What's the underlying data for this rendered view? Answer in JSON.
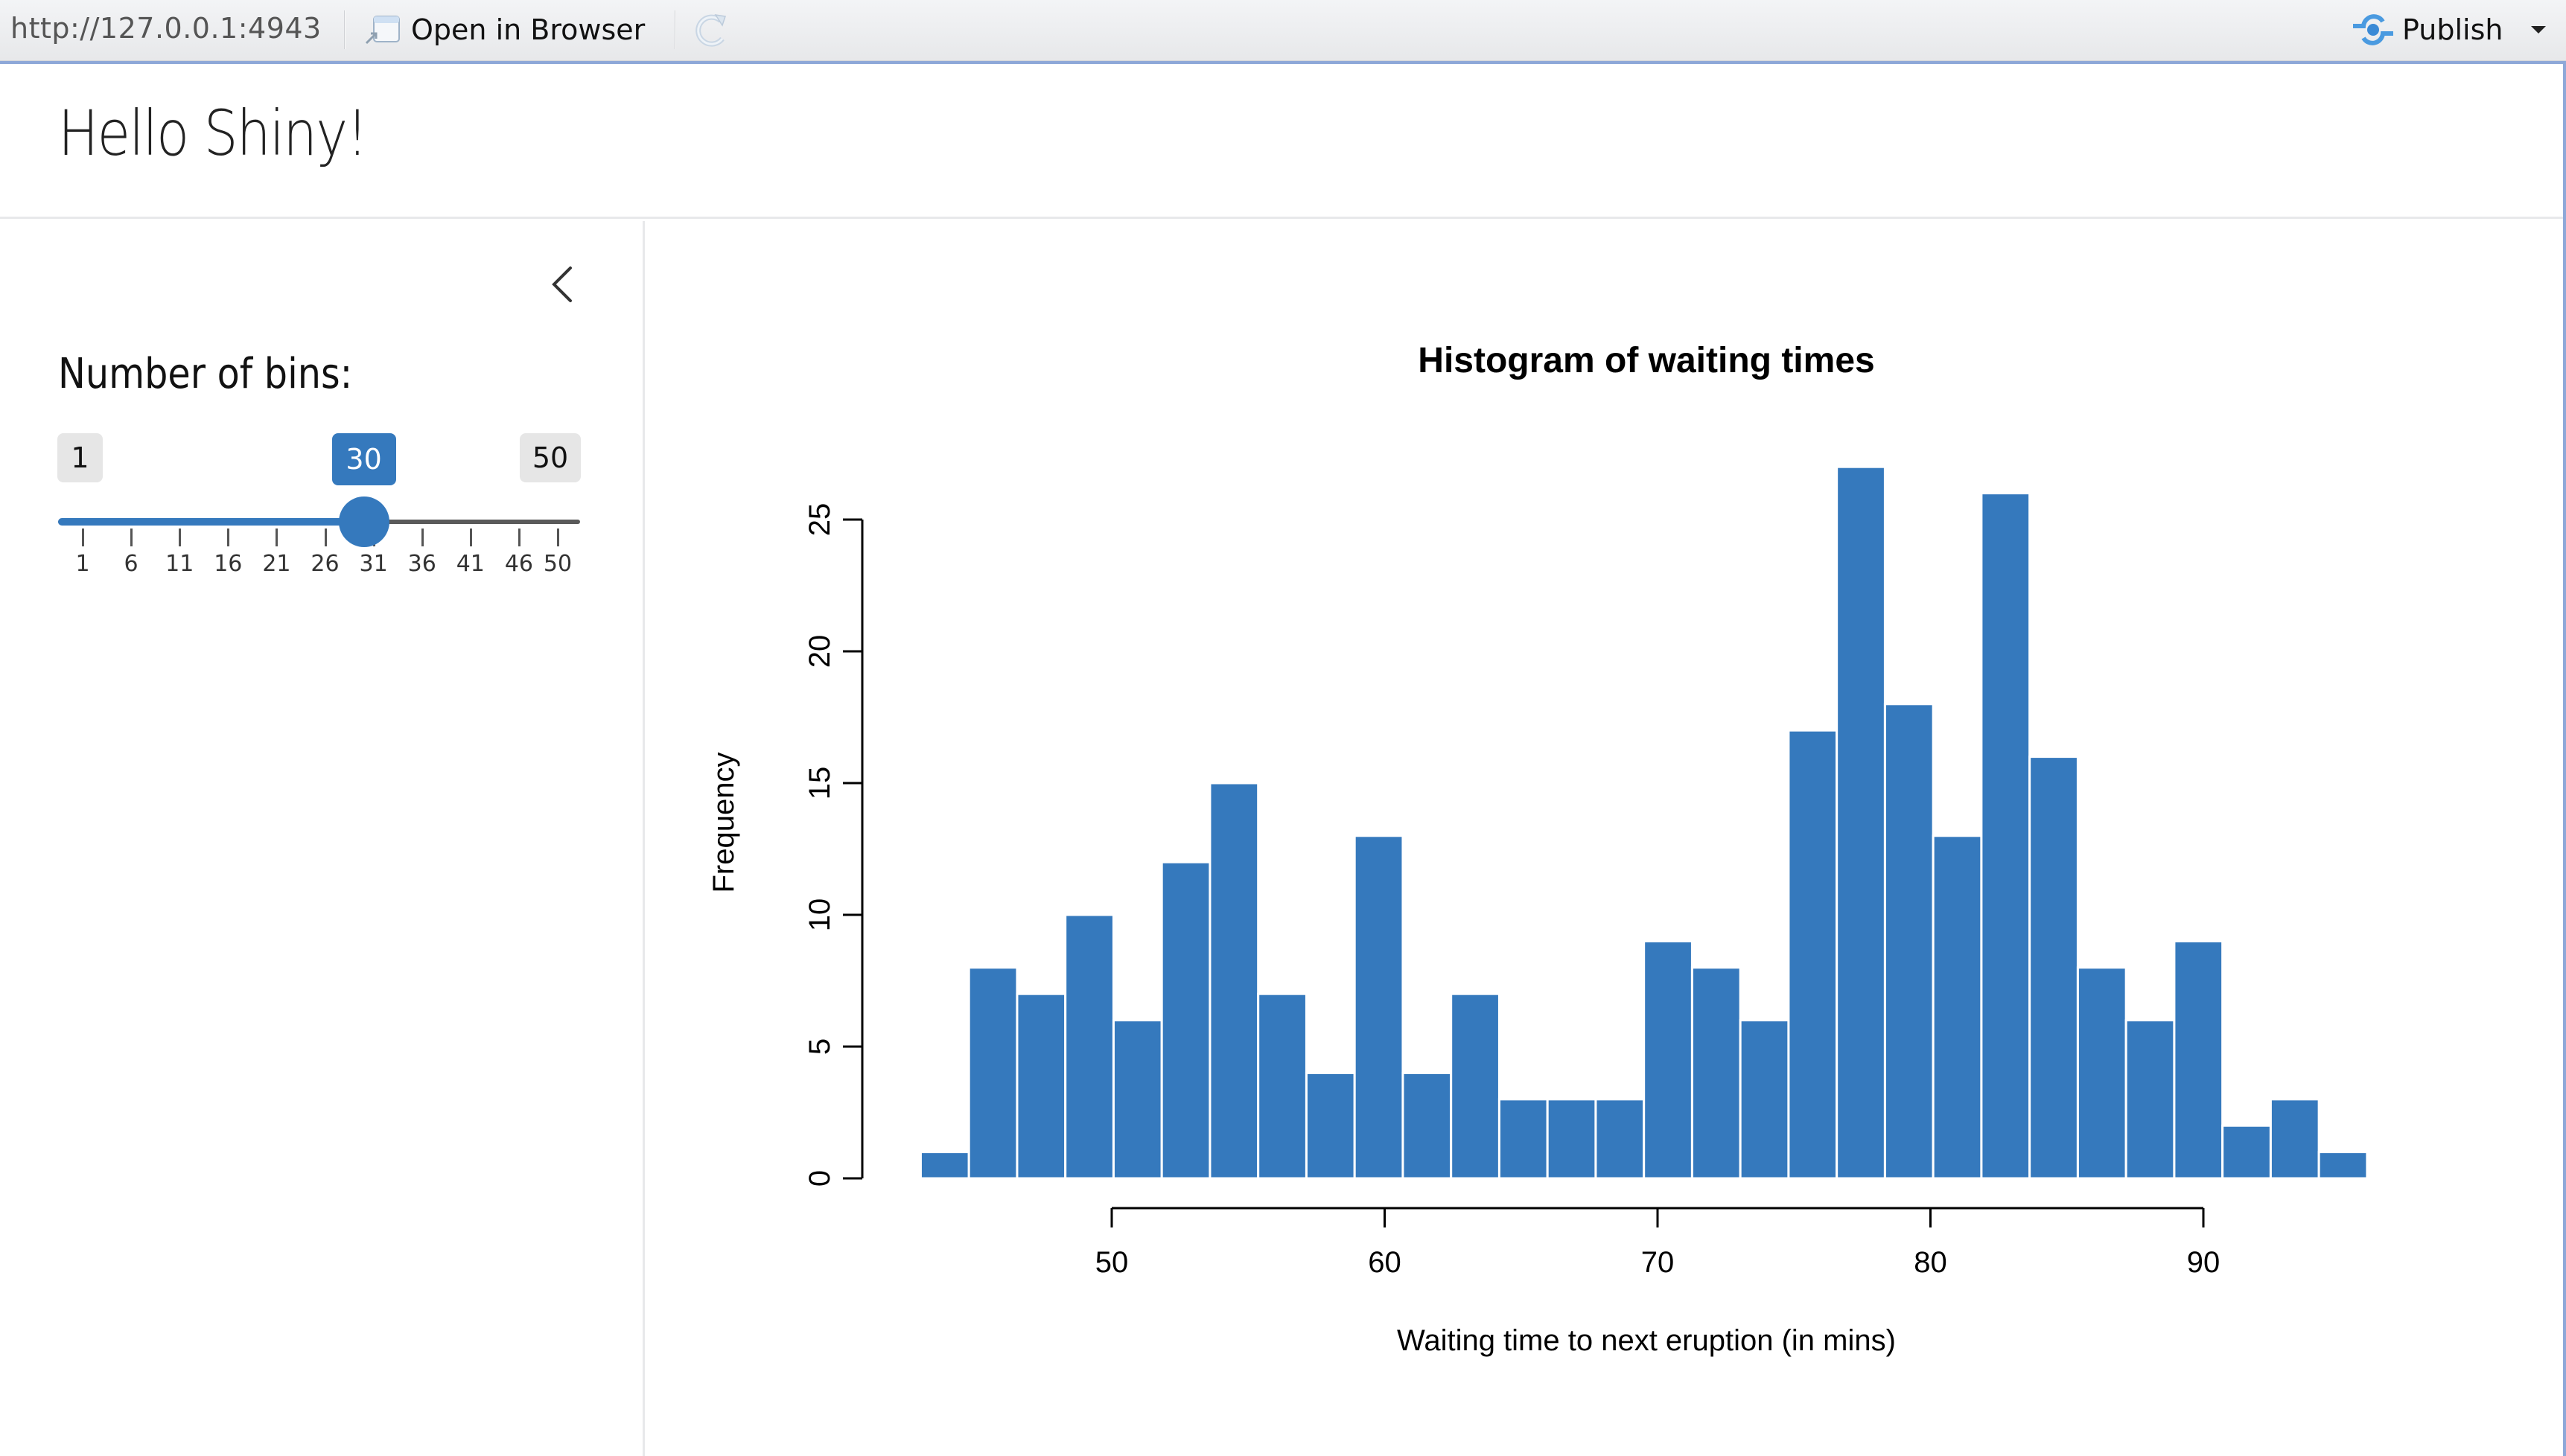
{
  "toolbar": {
    "url": "http://127.0.0.1:4943",
    "open_in_browser_label": "Open in Browser",
    "publish_label": "Publish"
  },
  "header": {
    "title": "Hello Shiny!"
  },
  "sidebar": {
    "input_label": "Number of bins:",
    "slider": {
      "min": 1,
      "max": 50,
      "value": 30,
      "min_label": "1",
      "max_label": "50",
      "value_label": "30",
      "tick_labels": [
        "1",
        "6",
        "11",
        "16",
        "21",
        "26",
        "31",
        "36",
        "41",
        "46",
        "50"
      ],
      "accent_color": "#3579bd"
    }
  },
  "chart_data": {
    "type": "bar",
    "title": "Histogram of waiting times",
    "xlabel": "Waiting time to next eruption (in mins)",
    "ylabel": "Frequency",
    "bin_start": 43,
    "bin_end": 96,
    "bin_count": 30,
    "values": [
      1,
      8,
      7,
      10,
      6,
      12,
      15,
      7,
      4,
      13,
      4,
      7,
      3,
      3,
      3,
      9,
      8,
      6,
      17,
      27,
      18,
      13,
      26,
      16,
      8,
      6,
      9,
      2,
      3,
      1
    ],
    "xticks": [
      50,
      60,
      70,
      80,
      90
    ],
    "yticks": [
      0,
      5,
      10,
      15,
      20,
      25
    ],
    "xlim": [
      50,
      90
    ],
    "ylim": [
      0,
      25
    ],
    "bar_color": "#3579bd",
    "bar_border_color": "#ffffff",
    "grid": false
  }
}
